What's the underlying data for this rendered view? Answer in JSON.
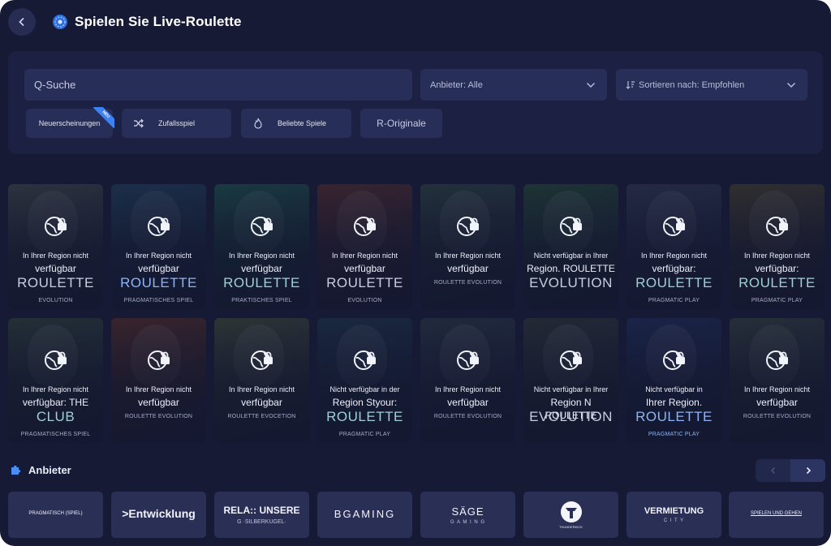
{
  "header": {
    "title": "Spielen Sie Live-Roulette",
    "back_icon": "chevron-left-icon",
    "title_icon": "roulette-icon"
  },
  "filters": {
    "search_placeholder": "Q-Suche",
    "provider_label": "Anbieter: Alle",
    "sort_label": "Sortieren nach: Empfohlen",
    "chips": [
      {
        "label": "Neuerscheinungen",
        "badge": "NEU"
      },
      {
        "label": "Zufallsspiel",
        "icon": "shuffle-icon"
      },
      {
        "label": "Beliebte Spiele",
        "icon": "flame-icon"
      },
      {
        "label": "R-Originale"
      }
    ]
  },
  "games": [
    {
      "line1": "In Ihrer Region nicht",
      "line2": "verfügbar",
      "brand": "ROULETTE",
      "provider": "EVOLUTION",
      "bg": "#3a3f46"
    },
    {
      "line1": "In Ihrer Region nicht",
      "line2": "verfügbar",
      "brand": "ROULETTE",
      "provider": "PRAGMATISCHES SPIEL",
      "bg": "#1f3a56"
    },
    {
      "line1": "In Ihrer Region nicht",
      "line2": "verfügbar",
      "brand": "ROULETTE",
      "provider": "PRAKTISCHES SPIEL",
      "bg": "#1c4a4a"
    },
    {
      "line1": "In Ihrer Region nicht",
      "line2": "verfügbar",
      "brand": "ROULETTE",
      "provider": "EVOLUTION",
      "bg": "#4a2a30"
    },
    {
      "line1": "In Ihrer Region nicht",
      "line2": "verfügbar",
      "brand": "",
      "provider": "ROULETTE EVOLUTION",
      "bg": "#2a3d42"
    },
    {
      "line1": "Nicht verfügbar in Ihrer",
      "line2": "Region. ROULETTE",
      "brand": "EVOLUTION",
      "provider": "",
      "bg": "#234238"
    },
    {
      "line1": "In Ihrer Region nicht",
      "line2": "verfügbar:",
      "brand": "ROULETTE",
      "provider": "PRAGMATIC PLAY",
      "bg": "#2c3350"
    },
    {
      "line1": "In Ihrer Region nicht",
      "line2": "verfügbar:",
      "brand": "ROULETTE",
      "provider": "PRAGMATIC PLAY",
      "bg": "#3d3a30"
    },
    {
      "line1": "In Ihrer Region nicht",
      "line2": "verfügbar: THE",
      "brand": "CLUB",
      "provider": "PRAGMATISCHES SPIEL",
      "bg": "#2b3a3a"
    },
    {
      "line1": "In Ihrer Region nicht",
      "line2": "verfügbar",
      "brand": "",
      "provider": "ROULETTE EVOLUTION",
      "bg": "#4a2a2a"
    },
    {
      "line1": "In Ihrer Region nicht",
      "line2": "verfügbar",
      "brand": "",
      "provider": "ROULETTE EVOCETION",
      "bg": "#3a4238"
    },
    {
      "line1": "Nicht verfügbar in der",
      "line2": "Region Styour:",
      "brand": "ROULETTE",
      "provider": "PRAGMATIC PLAY",
      "bg": "#1c3048"
    },
    {
      "line1": "In Ihrer Region nicht",
      "line2": "verfügbar",
      "brand": "",
      "provider": "ROULETTE EVOLUTION",
      "bg": "#273344"
    },
    {
      "line1": "Nicht verfügbar in Ihrer",
      "line2": "Region N ROULETTE",
      "brand": "EVOLUTION",
      "provider": "",
      "bg": "#2a3338"
    },
    {
      "line1": "Nicht verfügbar in",
      "line2": "Ihrer Region.",
      "brand": "ROULETTE",
      "provider": "PRAGMATIC PLAY",
      "bg": "#1e2a54"
    },
    {
      "line1": "In Ihrer Region nicht",
      "line2": "verfügbar",
      "brand": "",
      "provider": "ROULETTE EVOLUTION",
      "bg": "#2e3a3e"
    }
  ],
  "providers": {
    "title": "Anbieter",
    "title_icon": "puzzle-icon",
    "prev_icon": "chevron-left-icon",
    "next_icon": "chevron-right-icon",
    "items": [
      {
        "name": "PRAGMATISCH (SPIEL)",
        "sub": ""
      },
      {
        "name": ">Entwicklung",
        "sub": ""
      },
      {
        "name": "RELA:: UNSERE",
        "sub": "G   ·SILBERKUGEL·"
      },
      {
        "name": "BGAMING",
        "sub": ""
      },
      {
        "name": "SÄGE",
        "sub": "G A M I N G"
      },
      {
        "name": "",
        "sub": "THUNDERKICK"
      },
      {
        "name": "VERMIETUNG",
        "sub": "C I T Y"
      },
      {
        "name": "SPIELEN UND GEHEN",
        "sub": ""
      }
    ]
  },
  "colors": {
    "background": "#161a35",
    "panel": "#1c2143",
    "field": "#272e58",
    "accent": "#3b82f6"
  }
}
